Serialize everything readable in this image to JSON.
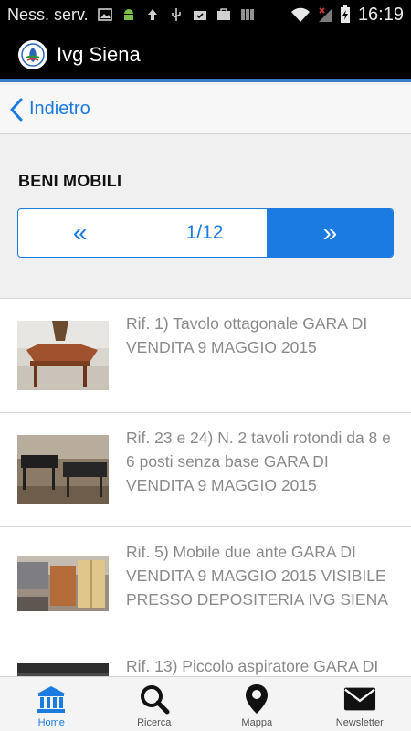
{
  "status_bar": {
    "carrier": "Ness. serv.",
    "time": "16:19"
  },
  "action_bar": {
    "title": "Ivg Siena"
  },
  "back": {
    "label": "Indietro"
  },
  "section": {
    "title": "BENI MOBILI"
  },
  "pager": {
    "prev_label": "«",
    "page_indicator": "1/12",
    "next_label": "»"
  },
  "items": [
    {
      "title": "Rif. 1) Tavolo ottagonale GARA DI VENDITA 9 MAGGIO 2015"
    },
    {
      "title": "Rif. 23 e 24) N. 2 tavoli rotondi da 8 e 6 posti senza base GARA DI VENDITA 9 MAGGIO 2015"
    },
    {
      "title": "Rif. 5) Mobile due ante GARA DI VENDITA 9 MAGGIO 2015 VISIBILE PRESSO DEPOSITERIA IVG SIENA"
    },
    {
      "title": "Rif. 13) Piccolo aspiratore GARA DI"
    }
  ],
  "tabs": [
    {
      "label": "Home",
      "icon": "bank-icon"
    },
    {
      "label": "Ricerca",
      "icon": "search-icon"
    },
    {
      "label": "Mappa",
      "icon": "map-pin-icon"
    },
    {
      "label": "Newsletter",
      "icon": "envelope-icon"
    }
  ],
  "colors": {
    "accent": "#1b7be0",
    "item_text": "#8a8a8a",
    "header_bg": "#000000"
  }
}
